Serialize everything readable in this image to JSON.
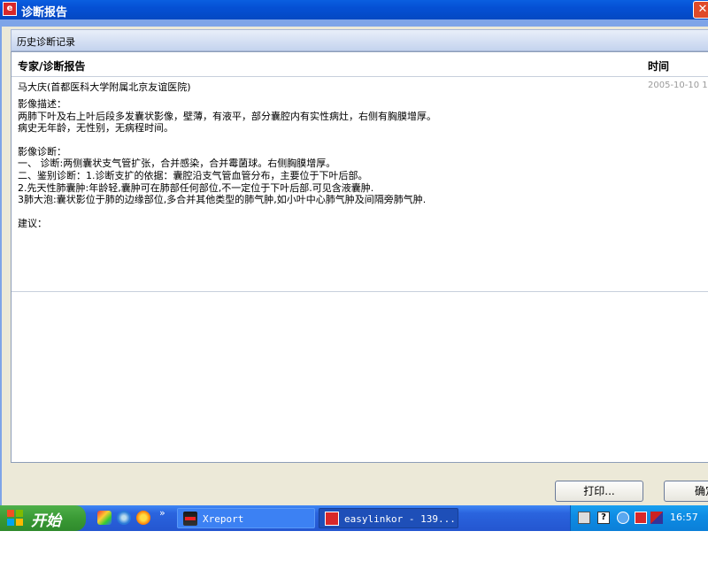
{
  "window": {
    "title": "诊断报告",
    "close_glyph": "✕"
  },
  "group": {
    "title": "历史诊断记录"
  },
  "table": {
    "headers": {
      "expert": "专家/诊断报告",
      "time": "时间"
    },
    "row": {
      "expert": "马大庆(首都医科大学附属北京友谊医院)",
      "time": "2005-10-10 1",
      "report": {
        "description_label": "影像描述：",
        "description_lines": [
          "两肺下叶及右上叶后段多发囊状影像，壁薄，有液平，部分囊腔内有实性病灶，右侧有胸膜增厚。",
          "病史无年龄，无性别，无病程时间。"
        ],
        "diagnosis_label": "影像诊断：",
        "diagnosis_lines": [
          "一、  诊断:两侧囊状支气管扩张，合并感染，合并霉菌球。右侧胸膜增厚。",
          "二、鉴别诊断：1.诊断支扩的依据：囊腔沿支气管血管分布，主要位于下叶后部。",
          "2.先天性肺囊肿:年龄轻,囊肿可在肺部任何部位,不一定位于下叶后部.可见含液囊肿.",
          "3肺大泡:囊状影位于肺的边缘部位,多合并其他类型的肺气肿,如小叶中心肺气肿及间隔旁肺气肿."
        ],
        "suggestion_label": "建议："
      }
    }
  },
  "buttons": {
    "print": "打印...",
    "confirm": "确定"
  },
  "taskbar": {
    "start_label": "开始",
    "more_glyph": "»",
    "tasks": [
      {
        "label": "Xreport",
        "icon": "xreport-icon"
      },
      {
        "label": "easylinkor - 139...",
        "icon": "easylinkor-icon"
      }
    ],
    "tray": {
      "help_glyph": "?",
      "clock": "16:57"
    }
  },
  "colors": {
    "titlebar": "#0550d4",
    "taskbar": "#2456d0",
    "start": "#3a9a35",
    "tray": "#0e8ce4",
    "close": "#e04a2a"
  }
}
